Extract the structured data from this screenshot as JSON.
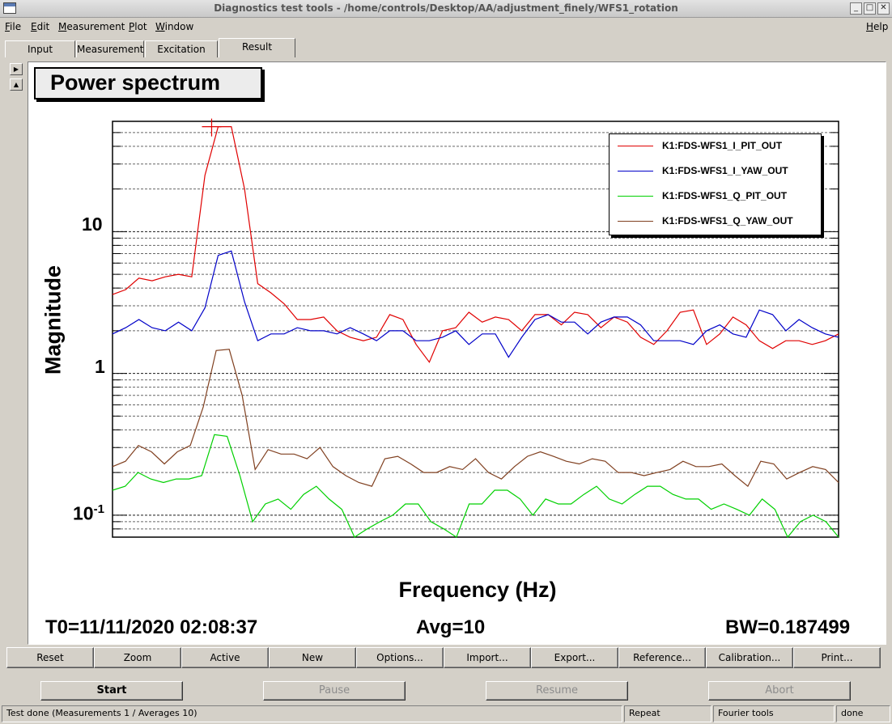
{
  "window": {
    "title": "Diagnostics test tools - /home/controls/Desktop/AA/adjustment_finely/WFS1_rotation",
    "icon": "app-window-icon",
    "controls": [
      "minimize",
      "maximize",
      "close"
    ]
  },
  "menubar": {
    "items": [
      "File",
      "Edit",
      "Measurement",
      "Plot",
      "Window"
    ],
    "help": "Help"
  },
  "tabs": [
    {
      "label": "Input"
    },
    {
      "label": "Measurement"
    },
    {
      "label": "Excitation"
    },
    {
      "label": "Result",
      "active": true
    }
  ],
  "plot": {
    "title": "Power spectrum",
    "footer": {
      "t0": "T0=11/11/2020 02:08:37",
      "avg": "Avg=10",
      "bw": "BW=0.187499"
    }
  },
  "chart_data": {
    "type": "line",
    "title": "Power spectrum",
    "xlabel": "Frequency (Hz)",
    "ylabel": "Magnitude",
    "yscale": "log",
    "ylim": [
      0.07,
      60
    ],
    "y_tick_labels": [
      "10",
      "1",
      "10^-1"
    ],
    "grid": true,
    "legend_position": "top-right",
    "x_tick_labels_shown": false,
    "series": [
      {
        "name": "K1:FDS-WFS1_I_PIT_OUT",
        "color": "#e00000",
        "values": [
          3.6,
          3.9,
          4.7,
          4.5,
          4.8,
          5.0,
          4.8,
          25.0,
          55.0,
          55.0,
          20.0,
          4.3,
          3.7,
          3.1,
          2.4,
          2.4,
          2.5,
          2.0,
          1.8,
          1.7,
          1.8,
          2.6,
          2.4,
          1.6,
          1.2,
          2.0,
          2.1,
          2.7,
          2.3,
          2.5,
          2.4,
          2.0,
          2.6,
          2.6,
          2.2,
          2.7,
          2.6,
          2.1,
          2.5,
          2.3,
          1.8,
          1.6,
          2.0,
          2.7,
          2.8,
          1.6,
          1.9,
          2.5,
          2.2,
          1.7,
          1.5,
          1.7,
          1.7,
          1.6,
          1.7,
          1.9
        ]
      },
      {
        "name": "K1:FDS-WFS1_I_YAW_OUT",
        "color": "#0000c8",
        "values": [
          1.9,
          2.1,
          2.4,
          2.1,
          2.0,
          2.3,
          2.0,
          2.9,
          6.8,
          7.3,
          3.2,
          1.7,
          1.9,
          1.9,
          2.1,
          2.0,
          2.0,
          1.9,
          2.1,
          1.9,
          1.7,
          2.0,
          2.0,
          1.7,
          1.7,
          1.8,
          2.0,
          1.6,
          1.9,
          1.9,
          1.3,
          1.8,
          2.4,
          2.6,
          2.3,
          2.3,
          1.9,
          2.3,
          2.5,
          2.5,
          2.2,
          1.7,
          1.7,
          1.7,
          1.6,
          2.0,
          2.2,
          1.9,
          1.8,
          2.8,
          2.6,
          2.0,
          2.4,
          2.1,
          1.9,
          1.8
        ]
      },
      {
        "name": "K1:FDS-WFS1_Q_PIT_OUT",
        "color": "#00d000",
        "values": [
          0.15,
          0.16,
          0.2,
          0.18,
          0.17,
          0.18,
          0.18,
          0.19,
          0.37,
          0.36,
          0.19,
          0.09,
          0.12,
          0.13,
          0.11,
          0.14,
          0.16,
          0.13,
          0.11,
          0.07,
          0.08,
          0.09,
          0.1,
          0.12,
          0.12,
          0.09,
          0.08,
          0.07,
          0.12,
          0.12,
          0.15,
          0.15,
          0.13,
          0.1,
          0.13,
          0.12,
          0.12,
          0.14,
          0.16,
          0.13,
          0.12,
          0.14,
          0.16,
          0.16,
          0.14,
          0.13,
          0.13,
          0.11,
          0.12,
          0.11,
          0.1,
          0.13,
          0.11,
          0.07,
          0.09,
          0.1,
          0.09,
          0.07
        ]
      },
      {
        "name": "K1:FDS-WFS1_Q_YAW_OUT",
        "color": "#804020",
        "values": [
          0.22,
          0.24,
          0.31,
          0.28,
          0.23,
          0.28,
          0.31,
          0.58,
          1.45,
          1.48,
          0.7,
          0.21,
          0.29,
          0.27,
          0.27,
          0.25,
          0.3,
          0.22,
          0.19,
          0.17,
          0.16,
          0.25,
          0.26,
          0.23,
          0.2,
          0.2,
          0.22,
          0.21,
          0.25,
          0.2,
          0.18,
          0.22,
          0.26,
          0.28,
          0.26,
          0.24,
          0.23,
          0.25,
          0.24,
          0.2,
          0.2,
          0.19,
          0.2,
          0.21,
          0.24,
          0.22,
          0.22,
          0.23,
          0.19,
          0.16,
          0.24,
          0.23,
          0.18,
          0.2,
          0.22,
          0.21,
          0.17
        ]
      }
    ],
    "marker": {
      "series": 0,
      "index": 8,
      "shape": "cross"
    }
  },
  "toolbar": {
    "buttons": [
      "Reset",
      "Zoom",
      "Active",
      "New",
      "Options...",
      "Import...",
      "Export...",
      "Reference...",
      "Calibration...",
      "Print..."
    ]
  },
  "controls": {
    "start": "Start",
    "pause": "Pause",
    "resume": "Resume",
    "abort": "Abort"
  },
  "status": {
    "message": "Test done (Measurements 1 / Averages 10)",
    "repeat": "Repeat",
    "mode": "Fourier tools",
    "state": "done"
  }
}
